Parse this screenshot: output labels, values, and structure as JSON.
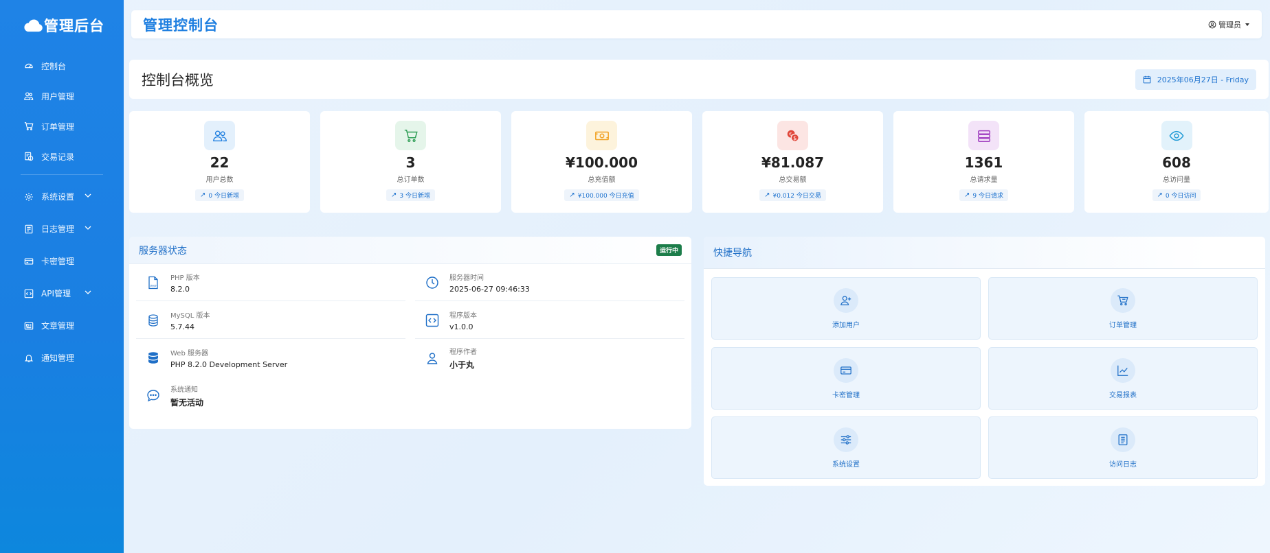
{
  "brand": {
    "name": "管理后台"
  },
  "sidebar": {
    "items": [
      {
        "label": "控制台",
        "icon": "dashboard-icon"
      },
      {
        "label": "用户管理",
        "icon": "users-icon"
      },
      {
        "label": "订单管理",
        "icon": "cart-icon"
      },
      {
        "label": "交易记录",
        "icon": "transaction-icon"
      },
      {
        "label": "系统设置",
        "icon": "gear-icon",
        "expandable": true
      },
      {
        "label": "日志管理",
        "icon": "log-icon",
        "expandable": true
      },
      {
        "label": "卡密管理",
        "icon": "card-icon"
      },
      {
        "label": "API管理",
        "icon": "api-icon",
        "expandable": true
      },
      {
        "label": "文章管理",
        "icon": "article-icon"
      },
      {
        "label": "通知管理",
        "icon": "bell-icon"
      }
    ]
  },
  "header": {
    "title": "管理控制台",
    "user_label": "管理员"
  },
  "overview": {
    "title": "控制台概览",
    "date": "2025年06月27日 - Friday"
  },
  "stats": [
    {
      "value": "22",
      "label": "用户总数",
      "trend": "0 今日新增",
      "icon": "users-icon",
      "color": "#1f7fe0",
      "bg": "#e3f0fc"
    },
    {
      "value": "3",
      "label": "总订单数",
      "trend": "3 今日新增",
      "icon": "cart-icon",
      "color": "#2e9e55",
      "bg": "#e5f5ea"
    },
    {
      "value": "¥100.000",
      "label": "总充值额",
      "trend": "¥100.000 今日充值",
      "icon": "money-icon",
      "color": "#f0a020",
      "bg": "#fdf3dc"
    },
    {
      "value": "¥81.087",
      "label": "总交易额",
      "trend": "¥0.012 今日交易",
      "icon": "coins-icon",
      "color": "#e0473a",
      "bg": "#fce5e3"
    },
    {
      "value": "1361",
      "label": "总请求量",
      "trend": "9 今日请求",
      "icon": "server-icon",
      "color": "#a03ec0",
      "bg": "#f3e3f8"
    },
    {
      "value": "608",
      "label": "总访问量",
      "trend": "0 今日访问",
      "icon": "eye-icon",
      "color": "#1f9ad6",
      "bg": "#e2f2fb"
    }
  ],
  "server": {
    "title": "服务器状态",
    "badge": "运行中",
    "items": [
      {
        "key": "PHP 版本",
        "value": "8.2.0",
        "icon": "php-file-icon"
      },
      {
        "key": "服务器时间",
        "value": "2025-06-27 09:46:33",
        "icon": "clock-icon"
      },
      {
        "key": "MySQL 版本",
        "value": "5.7.44",
        "icon": "database-icon"
      },
      {
        "key": "程序版本",
        "value": "v1.0.0",
        "icon": "code-icon"
      },
      {
        "key": "Web 服务器",
        "value": "PHP 8.2.0 Development Server",
        "icon": "server-stack-icon"
      },
      {
        "key": "程序作者",
        "value": "小于丸",
        "icon": "person-icon"
      },
      {
        "key": "系统通知",
        "value": "暂无活动",
        "icon": "chat-icon"
      }
    ]
  },
  "quick_nav": {
    "title": "快捷导航",
    "items": [
      {
        "label": "添加用户",
        "icon": "add-user-icon"
      },
      {
        "label": "订单管理",
        "icon": "cart-icon"
      },
      {
        "label": "卡密管理",
        "icon": "card-icon"
      },
      {
        "label": "交易报表",
        "icon": "chart-icon"
      },
      {
        "label": "系统设置",
        "icon": "sliders-icon"
      },
      {
        "label": "访问日志",
        "icon": "journal-icon"
      }
    ]
  },
  "colors": {
    "primary": "#1f7fe0",
    "sidebar": "#1a7fe2",
    "running": "#1c7d4a"
  }
}
